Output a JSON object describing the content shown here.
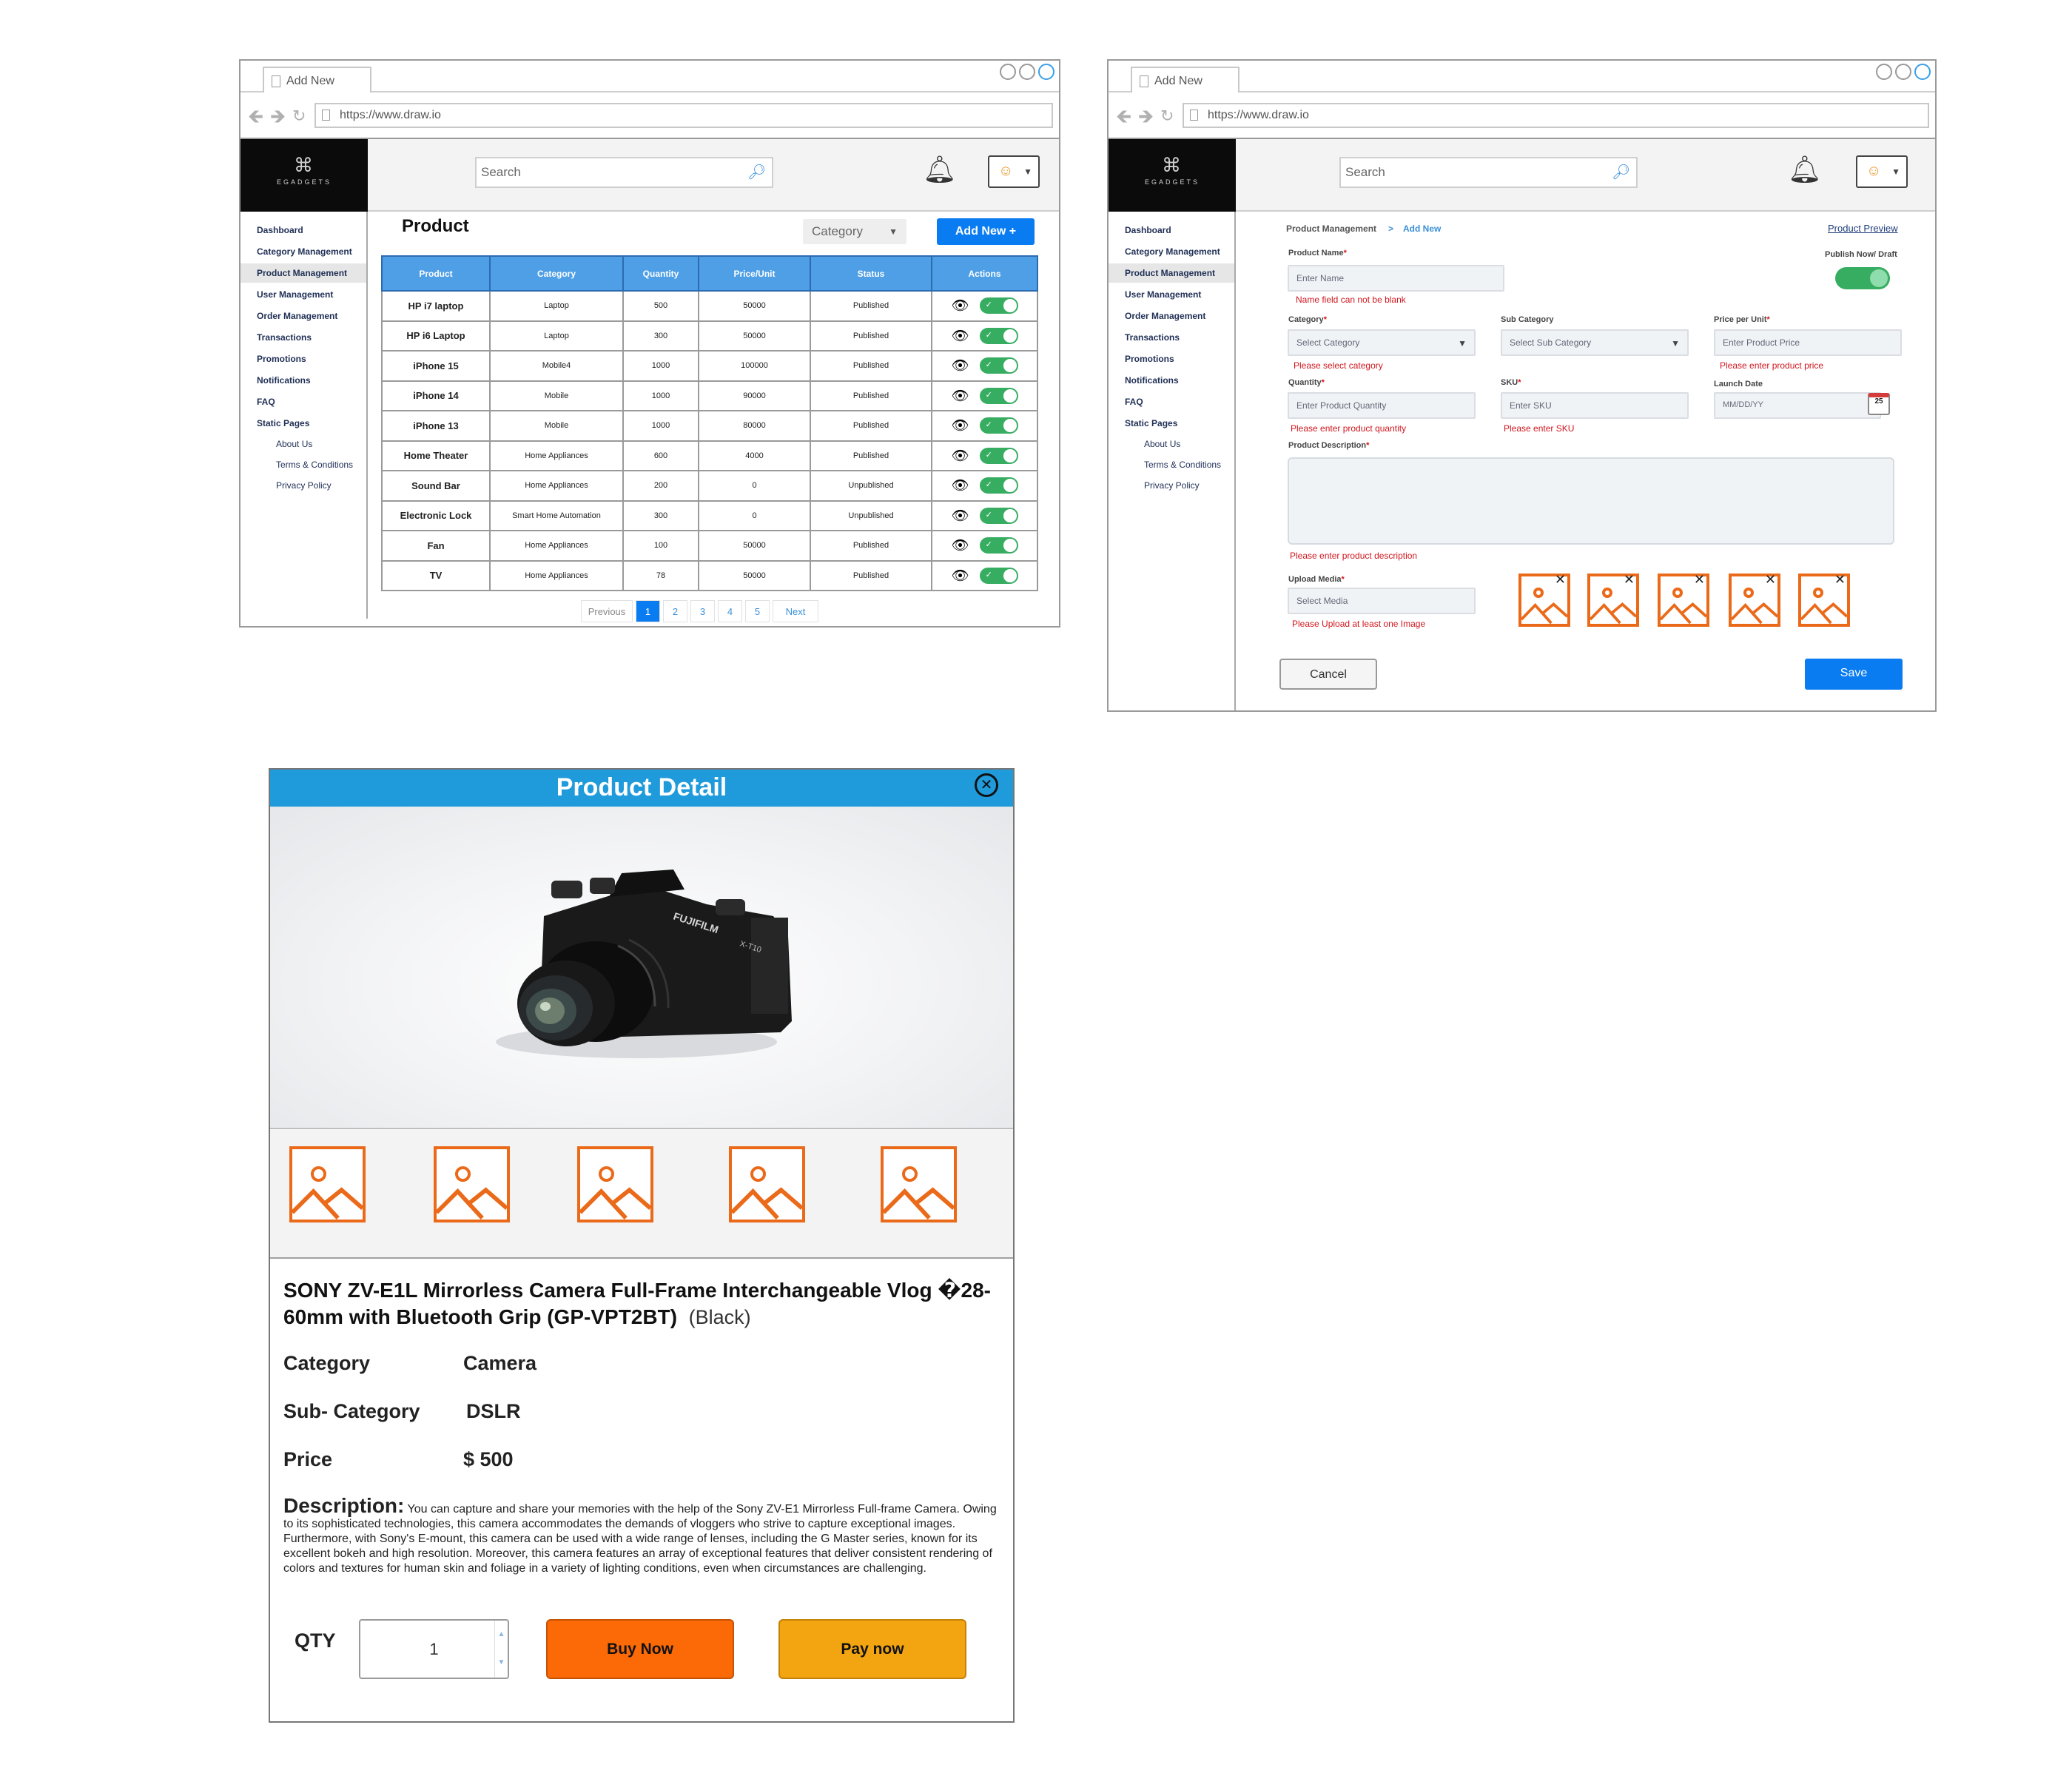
{
  "browser": {
    "tab_title": "Add New",
    "url": "https://www.draw.io"
  },
  "brand": {
    "name": "EGADGETS"
  },
  "header": {
    "search_placeholder": "Search"
  },
  "sidebar": {
    "items": [
      {
        "label": "Dashboard"
      },
      {
        "label": "Category Management"
      },
      {
        "label": "Product Management",
        "active": true
      },
      {
        "label": "User Management"
      },
      {
        "label": "Order Management"
      },
      {
        "label": "Transactions"
      },
      {
        "label": "Promotions"
      },
      {
        "label": "Notifications"
      },
      {
        "label": "FAQ"
      },
      {
        "label": "Static Pages"
      }
    ],
    "sub_items": [
      {
        "label": "About Us"
      },
      {
        "label": "Terms & Conditions"
      },
      {
        "label": "Privacy Policy"
      }
    ]
  },
  "product_list": {
    "title": "Product",
    "category_filter": "Category",
    "add_button": "Add New +",
    "columns": [
      "Product",
      "Category",
      "Quantity",
      "Price/Unit",
      "Status",
      "Actions"
    ],
    "rows": [
      {
        "product": "HP i7 laptop",
        "category": "Laptop",
        "quantity": "500",
        "price": "50000",
        "status": "Published"
      },
      {
        "product": "HP i6 Laptop",
        "category": "Laptop",
        "quantity": "300",
        "price": "50000",
        "status": "Published"
      },
      {
        "product": "iPhone 15",
        "category": "Mobile4",
        "quantity": "1000",
        "price": "100000",
        "status": "Published"
      },
      {
        "product": "iPhone 14",
        "category": "Mobile",
        "quantity": "1000",
        "price": "90000",
        "status": "Published"
      },
      {
        "product": "iPhone 13",
        "category": "Mobile",
        "quantity": "1000",
        "price": "80000",
        "status": "Published"
      },
      {
        "product": "Home Theater",
        "category": "Home Appliances",
        "quantity": "600",
        "price": "4000",
        "status": "Published"
      },
      {
        "product": "Sound Bar",
        "category": "Home Appliances",
        "quantity": "200",
        "price": "0",
        "status": "Unpublished"
      },
      {
        "product": "Electronic Lock",
        "category": "Smart Home Automation",
        "quantity": "300",
        "price": "0",
        "status": "Unpublished"
      },
      {
        "product": "Fan",
        "category": "Home Appliances",
        "quantity": "100",
        "price": "50000",
        "status": "Published"
      },
      {
        "product": "TV",
        "category": "Home Appliances",
        "quantity": "78",
        "price": "50000",
        "status": "Published"
      }
    ],
    "pagination": {
      "previous": "Previous",
      "pages": [
        "1",
        "2",
        "3",
        "4",
        "5"
      ],
      "current": "1",
      "next": "Next"
    }
  },
  "add_form": {
    "breadcrumb": {
      "parent": "Product Management",
      "separator": ">",
      "current": "Add New"
    },
    "preview_link": "Product Preview",
    "publish_label": "Publish Now/ Draft",
    "product_name": {
      "label": "Product Name",
      "placeholder": "Enter Name",
      "error": "Name field can not be blank"
    },
    "category": {
      "label": "Category",
      "placeholder": "Select Category",
      "error": "Please select  category"
    },
    "sub_category": {
      "label": "Sub Category",
      "placeholder": "Select Sub Category"
    },
    "price": {
      "label": "Price per Unit",
      "placeholder": "Enter Product Price",
      "error": "Please enter product price"
    },
    "quantity": {
      "label": "Quantity",
      "placeholder": "Enter Product Quantity",
      "error": "Please enter product quantity"
    },
    "sku": {
      "label": "SKU",
      "placeholder": "Enter SKU",
      "error": "Please enter SKU"
    },
    "launch_date": {
      "label": "Launch  Date",
      "placeholder": "MM/DD/YY",
      "calendar_day": "25"
    },
    "description": {
      "label": "Product Description",
      "error": "Please enter product description"
    },
    "media": {
      "label": "Upload  Media",
      "placeholder": "Select Media",
      "error": "Please Upload at least one Image"
    },
    "required_mark": "*",
    "cancel": "Cancel",
    "save": "Save"
  },
  "product_detail": {
    "header": "Product Detail",
    "title": "SONY ZV-E1L Mirrorless Camera Full-Frame Interchangeable Vlog �28-60mm with Bluetooth Grip (GP-VPT2BT)",
    "variant": "(Black)",
    "category_label": "Category",
    "category_value": "Camera",
    "subcategory_label": "Sub- Category",
    "subcategory_value": "DSLR",
    "price_label": "Price",
    "price_value": "$ 500",
    "description_label": "Description:",
    "description_text": "You can capture and share your memories with the help of the Sony ZV-E1 Mirrorless Full-frame Camera. Owing to its sophisticated technologies, this camera accommodates the demands of vloggers who strive to capture exceptional images. Furthermore, with Sony's E-mount, this camera can be used with a wide range of lenses, including the G Master series, known for its excellent bokeh and high resolution. Moreover, this camera features an array of exceptional features that deliver consistent rendering of colors and textures for human skin and foliage in a variety of lighting conditions, even when circumstances are challenging.",
    "camera_brand": "FUJIFILM",
    "camera_model": "X-T10",
    "qty_label": "QTY",
    "qty_value": "1",
    "buy_now": "Buy Now",
    "pay_now": "Pay now"
  },
  "colors": {
    "primary_blue": "#0a7cf2",
    "header_blue": "#1f9bdc",
    "table_head": "#4e9fe6",
    "toggle_green": "#37ad62",
    "error_red": "#d0161d",
    "placeholder_orange": "#ea6a1a",
    "buy_orange": "#fb6a06",
    "pay_amber": "#f2a510"
  }
}
